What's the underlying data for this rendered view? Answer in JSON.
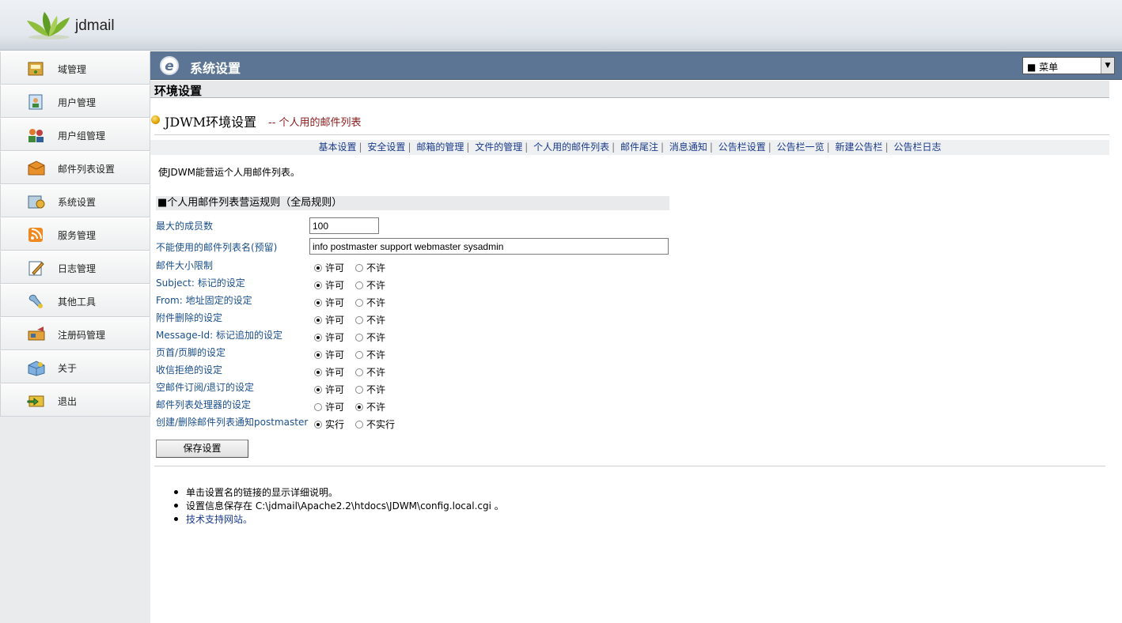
{
  "brand": "jdmail",
  "sidebar": {
    "items": [
      {
        "label": "域管理",
        "icon": "domain-icon"
      },
      {
        "label": "用户管理",
        "icon": "user-icon"
      },
      {
        "label": "用户组管理",
        "icon": "user-group-icon"
      },
      {
        "label": "邮件列表设置",
        "icon": "mailing-list-icon"
      },
      {
        "label": "系统设置",
        "icon": "system-settings-icon"
      },
      {
        "label": "服务管理",
        "icon": "service-icon"
      },
      {
        "label": "日志管理",
        "icon": "log-icon"
      },
      {
        "label": "其他工具",
        "icon": "tools-icon"
      },
      {
        "label": "注册码管理",
        "icon": "registration-icon"
      },
      {
        "label": "关于",
        "icon": "about-icon"
      },
      {
        "label": "退出",
        "icon": "logout-icon"
      }
    ]
  },
  "header": {
    "title": "系统设置",
    "menu_value": "■ 菜单"
  },
  "section_title": "环境设置",
  "page": {
    "title": "JDWM环境设置",
    "subtitle": "-- 个人用的邮件列表",
    "description": "使JDWM能营运个人用邮件列表。",
    "rules_heading": "■个人用邮件列表营运规则（全局规则）"
  },
  "nav": [
    "基本设置",
    "安全设置",
    "邮箱的管理",
    "文件的管理",
    "个人用的邮件列表",
    "邮件尾注",
    "消息通知",
    "公告栏设置",
    "公告栏一览",
    "新建公告栏",
    "公告栏日志"
  ],
  "fields": {
    "max_members": {
      "label": "最大的成员数",
      "value": "100"
    },
    "reserved_names": {
      "label": "不能使用的邮件列表名(预留)",
      "value": "info postmaster support webmaster sysadmin"
    }
  },
  "radio_rows": [
    {
      "label": "邮件大小限制",
      "opt1": "许可",
      "opt2": "不许",
      "selected": 1
    },
    {
      "label": "Subject: 标记的设定",
      "opt1": "许可",
      "opt2": "不许",
      "selected": 1
    },
    {
      "label": "From: 地址固定的设定",
      "opt1": "许可",
      "opt2": "不许",
      "selected": 1
    },
    {
      "label": "附件删除的设定",
      "opt1": "许可",
      "opt2": "不许",
      "selected": 1
    },
    {
      "label": "Message-Id: 标记追加的设定",
      "opt1": "许可",
      "opt2": "不许",
      "selected": 1
    },
    {
      "label": "页首/页脚的设定",
      "opt1": "许可",
      "opt2": "不许",
      "selected": 1
    },
    {
      "label": "收信拒绝的设定",
      "opt1": "许可",
      "opt2": "不许",
      "selected": 1
    },
    {
      "label": "空邮件订阅/退订的设定",
      "opt1": "许可",
      "opt2": "不许",
      "selected": 1
    },
    {
      "label": "邮件列表处理器的设定",
      "opt1": "许可",
      "opt2": "不许",
      "selected": 2
    },
    {
      "label": "创建/删除邮件列表通知postmaster",
      "opt1": "实行",
      "opt2": "不实行",
      "selected": 1
    }
  ],
  "save_label": "保存设置",
  "notes": {
    "n1": "单击设置名的链接的显示详细说明。",
    "n2": "设置信息保存在 C:\\jdmail\\Apache2.2\\htdocs\\JDWM\\config.local.cgi 。",
    "n3": "技术支持网站。"
  }
}
